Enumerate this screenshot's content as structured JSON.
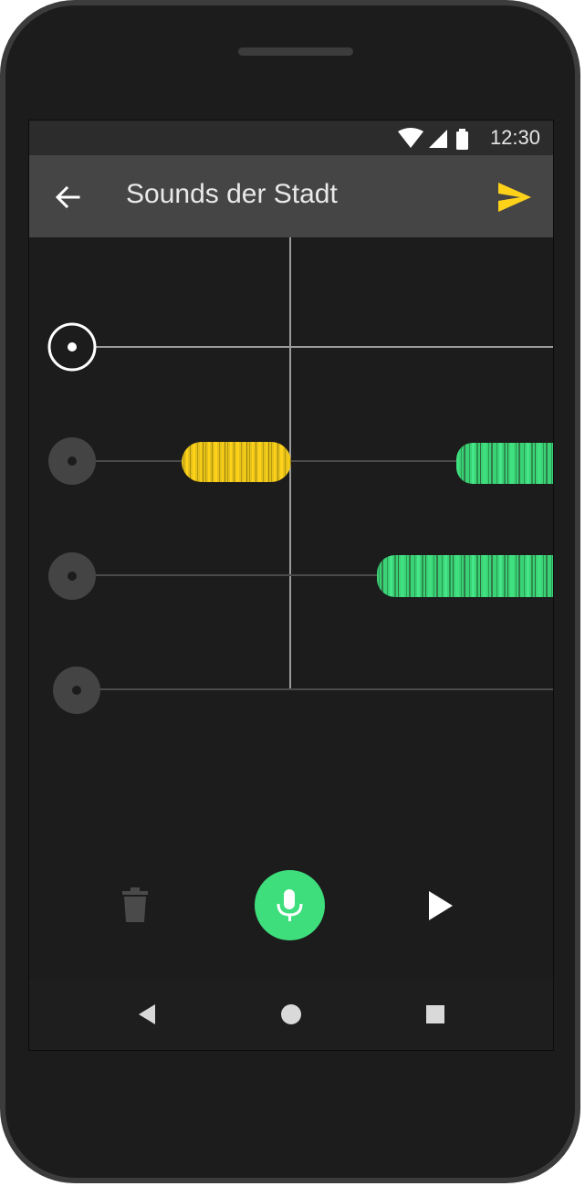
{
  "status_bar": {
    "time": "12:30",
    "icons": [
      "wifi-icon",
      "signal-icon",
      "battery-icon"
    ]
  },
  "app_bar": {
    "title": "Sounds der Stadt",
    "back_icon": "arrow-left-icon",
    "send_icon": "send-icon",
    "send_color": "#ffd21a"
  },
  "tracks": [
    {
      "name": "track-1",
      "selected": true,
      "clips": []
    },
    {
      "name": "track-2",
      "selected": false,
      "clips": [
        {
          "color": "#f2c51d"
        },
        {
          "color": "#3ede7d"
        }
      ]
    },
    {
      "name": "track-3",
      "selected": false,
      "clips": [
        {
          "color": "#3ede7d"
        }
      ]
    },
    {
      "name": "track-4",
      "selected": false,
      "clips": []
    }
  ],
  "controls": {
    "delete_icon": "trash-icon",
    "record_icon": "microphone-icon",
    "record_color": "#3ede7d",
    "play_icon": "play-icon"
  },
  "nav_bar": {
    "icons": [
      "nav-back-icon",
      "nav-home-icon",
      "nav-recents-icon"
    ]
  }
}
